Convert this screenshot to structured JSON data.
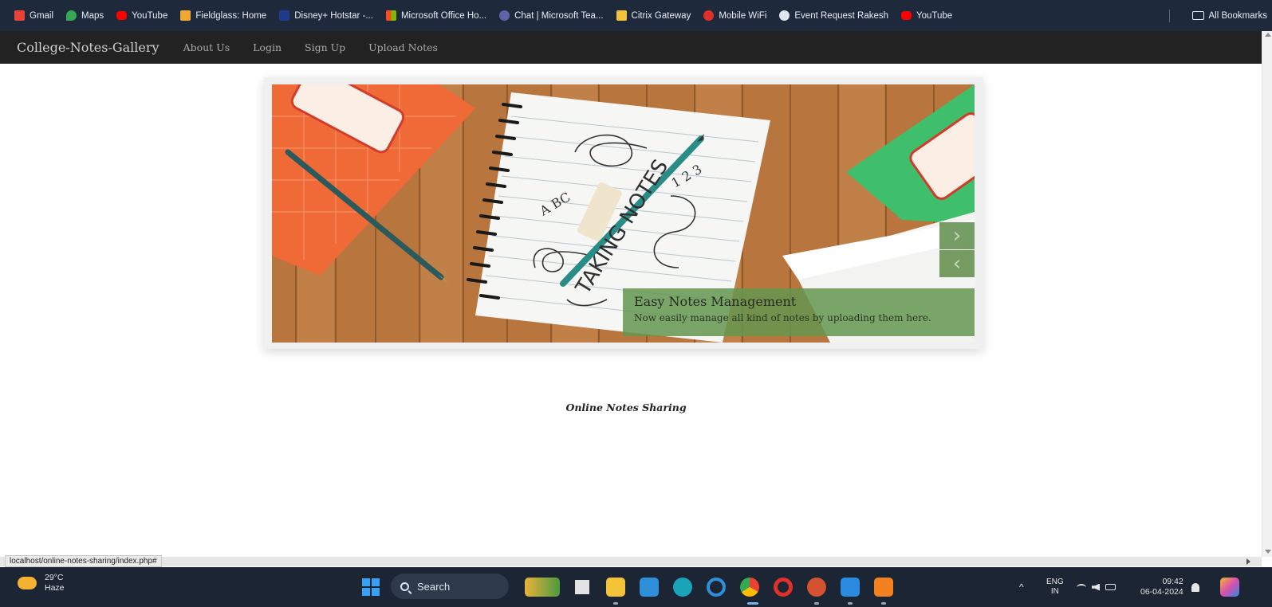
{
  "browser": {
    "bookmarks": [
      {
        "label": "Gmail",
        "icon": "gmail-icon",
        "color": "#ea4335"
      },
      {
        "label": "Maps",
        "icon": "maps-icon",
        "color": "#34a853"
      },
      {
        "label": "YouTube",
        "icon": "youtube-icon",
        "color": "#ff0000"
      },
      {
        "label": "Fieldglass: Home",
        "icon": "fieldglass-icon",
        "color": "#f0a830"
      },
      {
        "label": "Disney+ Hotstar -...",
        "icon": "hotstar-icon",
        "color": "#1f3a8a"
      },
      {
        "label": "Microsoft Office Ho...",
        "icon": "office-icon",
        "color": "#f25022"
      },
      {
        "label": "Chat | Microsoft Tea...",
        "icon": "teams-icon",
        "color": "#6264a7"
      },
      {
        "label": "Citrix Gateway",
        "icon": "citrix-icon",
        "color": "#f3c23b"
      },
      {
        "label": "Mobile WiFi",
        "icon": "wifi-bookmark-icon",
        "color": "#e0302a"
      },
      {
        "label": "Event Request Rakesh",
        "icon": "globe-icon",
        "color": "#dfe5ee"
      },
      {
        "label": "YouTube",
        "icon": "youtube-icon",
        "color": "#ff0000"
      }
    ],
    "all_bookmarks": "All Bookmarks",
    "status_url": "localhost/online-notes-sharing/index.php#"
  },
  "site": {
    "brand": "College-Notes-Gallery",
    "nav": [
      "About Us",
      "Login",
      "Sign Up",
      "Upload Notes"
    ],
    "slide": {
      "art_text": "TAKING NOTES",
      "abc": "A BC",
      "nums": "1 2 3",
      "caption_title": "Easy Notes Management",
      "caption_text": "Now easily manage all kind of notes by uploading them here.",
      "next_symbol": "›",
      "prev_symbol": "‹"
    },
    "tagline": "Online Notes Sharing"
  },
  "taskbar": {
    "temperature": "29°C",
    "weather": "Haze",
    "search_label": "Search",
    "lang_top": "ENG",
    "lang_bottom": "IN",
    "time": "09:42",
    "date": "06-04-2024"
  }
}
